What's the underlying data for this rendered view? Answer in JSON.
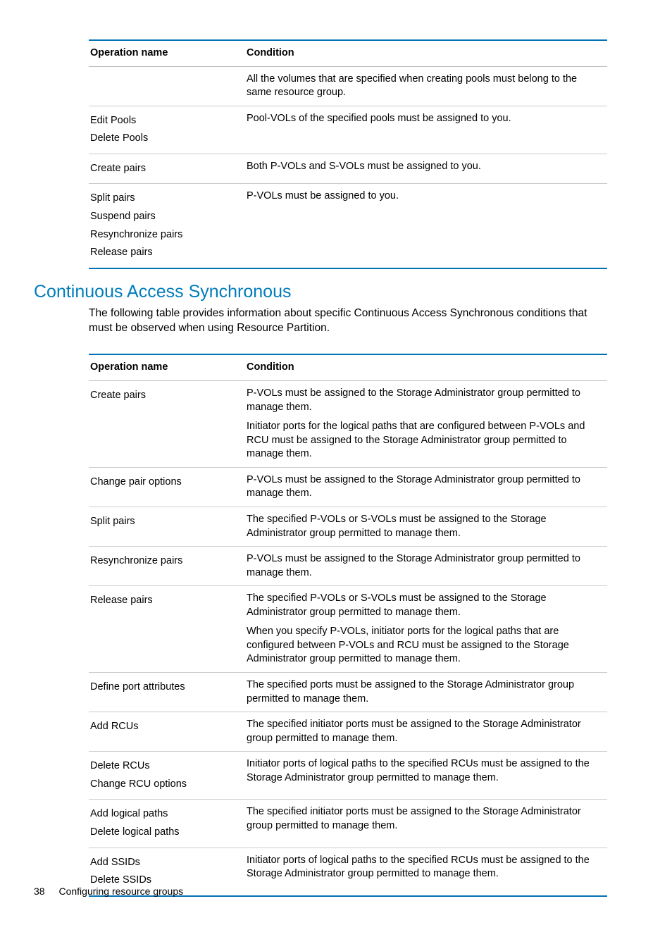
{
  "table1": {
    "headers": {
      "op": "Operation name",
      "cond": "Condition"
    },
    "rows": [
      {
        "ops": [
          ""
        ],
        "cond": [
          "All the volumes that are specified when creating pools must belong to the same resource group."
        ]
      },
      {
        "ops": [
          "Edit Pools",
          "Delete Pools"
        ],
        "cond": [
          "Pool-VOLs of the specified pools must be assigned to you."
        ]
      },
      {
        "ops": [
          "Create pairs"
        ],
        "cond": [
          "Both P-VOLs and S-VOLs must be assigned to you."
        ]
      },
      {
        "ops": [
          "Split pairs",
          "Suspend pairs",
          "Resynchronize pairs",
          "Release pairs"
        ],
        "cond": [
          "P-VOLs must be assigned to you."
        ]
      }
    ]
  },
  "section": {
    "title": "Continuous Access Synchronous",
    "intro": "The following table provides information about specific Continuous Access Synchronous conditions that must be observed when using Resource Partition."
  },
  "table2": {
    "headers": {
      "op": "Operation name",
      "cond": "Condition"
    },
    "rows": [
      {
        "ops": [
          "Create pairs"
        ],
        "cond": [
          "P-VOLs must be assigned to the Storage Administrator group permitted to manage them.",
          "Initiator ports for the logical paths that are configured between P-VOLs and RCU must be assigned to the Storage Administrator group permitted to manage them."
        ]
      },
      {
        "ops": [
          "Change pair options"
        ],
        "cond": [
          "P-VOLs must be assigned to the Storage Administrator group permitted to manage them."
        ]
      },
      {
        "ops": [
          "Split pairs"
        ],
        "cond": [
          "The specified P-VOLs or S-VOLs must be assigned to the Storage Administrator group permitted to manage them."
        ]
      },
      {
        "ops": [
          "Resynchronize pairs"
        ],
        "cond": [
          "P-VOLs must be assigned to the Storage Administrator group permitted to manage them."
        ]
      },
      {
        "ops": [
          "Release pairs"
        ],
        "cond": [
          "The specified P-VOLs or S-VOLs must be assigned to the Storage Administrator group permitted to manage them.",
          "When you specify P-VOLs, initiator ports for the logical paths that are configured between P-VOLs and RCU must be assigned to the Storage Administrator group permitted to manage them."
        ]
      },
      {
        "ops": [
          "Define port attributes"
        ],
        "cond": [
          "The specified ports must be assigned to the Storage Administrator group permitted to manage them."
        ]
      },
      {
        "ops": [
          "Add RCUs"
        ],
        "cond": [
          "The specified initiator ports must be assigned to the Storage Administrator group permitted to manage them."
        ]
      },
      {
        "ops": [
          "Delete RCUs",
          "Change RCU options"
        ],
        "cond": [
          "Initiator ports of logical paths to the specified RCUs must be assigned to the Storage Administrator group permitted to manage them."
        ]
      },
      {
        "ops": [
          "Add logical paths",
          "Delete logical paths"
        ],
        "cond": [
          "The specified initiator ports must be assigned to the Storage Administrator group permitted to manage them."
        ]
      },
      {
        "ops": [
          "Add SSIDs",
          "Delete SSIDs"
        ],
        "cond": [
          "Initiator ports of logical paths to the specified RCUs must be assigned to the Storage Administrator group permitted to manage them."
        ]
      }
    ]
  },
  "footer": {
    "page": "38",
    "section": "Configuring resource groups"
  }
}
